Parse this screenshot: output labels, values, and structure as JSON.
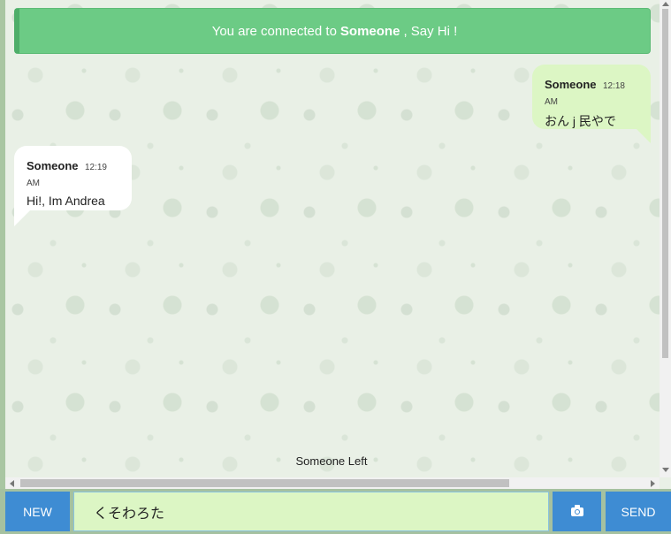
{
  "banner": {
    "prefix": "You are connected to",
    "partner": "Someone",
    "suffix": ", Say Hi !"
  },
  "messages": [
    {
      "side": "right",
      "sender": "Someone",
      "time": "12:18 AM",
      "text": "おん j 民やで"
    },
    {
      "side": "left",
      "sender": "Someone",
      "time": "12:19 AM",
      "text": "Hi!, Im Andrea"
    }
  ],
  "system_message": "Someone Left",
  "composer": {
    "new_label": "NEW",
    "input_value": "くそわろた",
    "camera_icon": "camera-icon",
    "send_label": "SEND"
  },
  "colors": {
    "banner": "#6ccb85",
    "own_bubble": "#dcf6c4",
    "other_bubble": "#ffffff",
    "button": "#3e8cd3"
  }
}
